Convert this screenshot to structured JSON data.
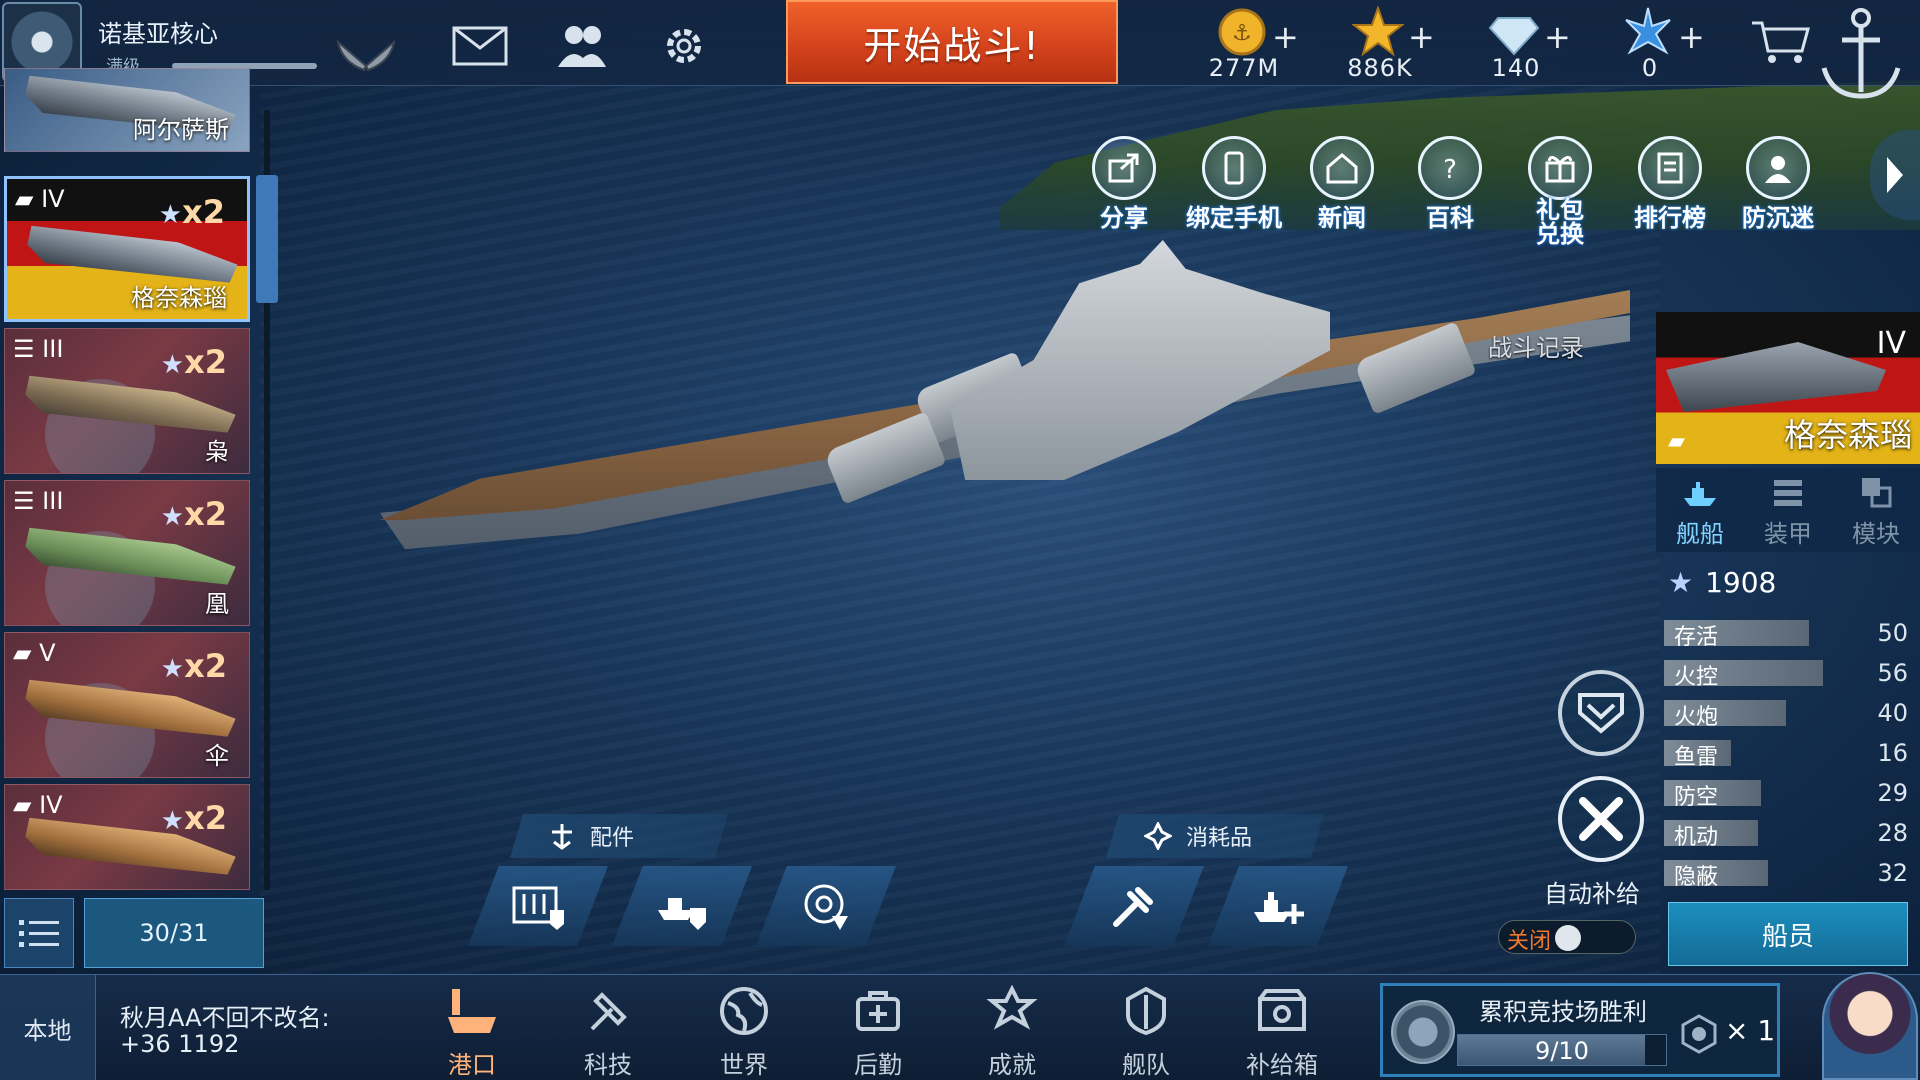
{
  "player": {
    "name": "诺基亚核心",
    "level_label": "满级"
  },
  "top_icons": [
    "mail-icon",
    "friends-icon",
    "settings-icon"
  ],
  "battle_button": "开始战斗!",
  "currencies": [
    {
      "icon": "gold-coin-icon",
      "value": "277M"
    },
    {
      "icon": "star-icon",
      "value": "886K"
    },
    {
      "icon": "diamond-icon",
      "value": "140"
    },
    {
      "icon": "blue-gem-icon",
      "value": "0"
    }
  ],
  "shop_icon": "shopping-cart-icon",
  "anchor_icon": "anchor-icon",
  "ship_list": {
    "top_partial_name": "阿尔萨斯",
    "cards": [
      {
        "tier": "IV",
        "multiplier": "x2",
        "name": "格奈森瑙",
        "selected": true
      },
      {
        "tier": "III",
        "multiplier": "x2",
        "name": "枭",
        "selected": false
      },
      {
        "tier": "III",
        "multiplier": "x2",
        "name": "凰",
        "selected": false
      },
      {
        "tier": "V",
        "multiplier": "x2",
        "name": "伞",
        "selected": false
      },
      {
        "tier": "IV",
        "multiplier": "x2",
        "name": "",
        "selected": false
      }
    ],
    "count": "30/31"
  },
  "functions": [
    {
      "icon": "share-icon",
      "label": "分享"
    },
    {
      "icon": "bind-phone-icon",
      "label": "绑定手机"
    },
    {
      "icon": "news-icon",
      "label": "新闻"
    },
    {
      "icon": "encyclopedia-icon",
      "label": "百科"
    },
    {
      "icon": "gift-exchange-icon",
      "label": "礼包兑换"
    },
    {
      "icon": "leaderboard-icon",
      "label": "排行榜"
    },
    {
      "icon": "anti-addiction-icon",
      "label": "防沉迷"
    }
  ],
  "battle_record_label": "战斗记录",
  "selected_ship": {
    "tier": "IV",
    "name": "格奈森瑙",
    "tabs": [
      {
        "icon": "ship-icon",
        "label": "舰船",
        "active": true
      },
      {
        "icon": "armor-icon",
        "label": "装甲",
        "active": false
      },
      {
        "icon": "module-icon",
        "label": "模块",
        "active": false
      }
    ],
    "rating": "1908",
    "stats": [
      {
        "label": "存活",
        "value": "50",
        "level": 0.5
      },
      {
        "label": "火控",
        "value": "56",
        "level": 0.56
      },
      {
        "label": "火炮",
        "value": "40",
        "level": 0.4
      },
      {
        "label": "鱼雷",
        "value": "16",
        "level": 0.16
      },
      {
        "label": "防空",
        "value": "29",
        "level": 0.29
      },
      {
        "label": "机动",
        "value": "28",
        "level": 0.28
      },
      {
        "label": "隐蔽",
        "value": "32",
        "level": 0.32
      }
    ],
    "crew_button": "船员"
  },
  "equipment": {
    "parts_label": "配件",
    "consumables_label": "消耗品"
  },
  "auto_supply": {
    "label": "自动补给",
    "state": "关闭"
  },
  "bottom": {
    "local_label": "本地",
    "chat_name": "秋月AA不回不改名:",
    "chat_text": "+36 1192",
    "nav": [
      {
        "icon": "harbor-icon",
        "label": "港口",
        "active": true
      },
      {
        "icon": "tech-icon",
        "label": "科技",
        "active": false
      },
      {
        "icon": "world-icon",
        "label": "世界",
        "active": false
      },
      {
        "icon": "logistics-icon",
        "label": "后勤",
        "active": false
      },
      {
        "icon": "achievement-icon",
        "label": "成就",
        "active": false
      },
      {
        "icon": "fleet-icon",
        "label": "舰队",
        "active": false
      },
      {
        "icon": "supply-box-icon",
        "label": "补给箱",
        "active": false
      }
    ],
    "arena": {
      "title": "累积竞技场胜利",
      "progress_text": "9/10",
      "progress": 0.9,
      "reward_count": "× 1"
    }
  },
  "colors": {
    "battle_orange": "#d2411b",
    "accent_blue": "#3f79b8",
    "active_nav": "#ffb37a",
    "func_glow": "#1e6fcf"
  }
}
